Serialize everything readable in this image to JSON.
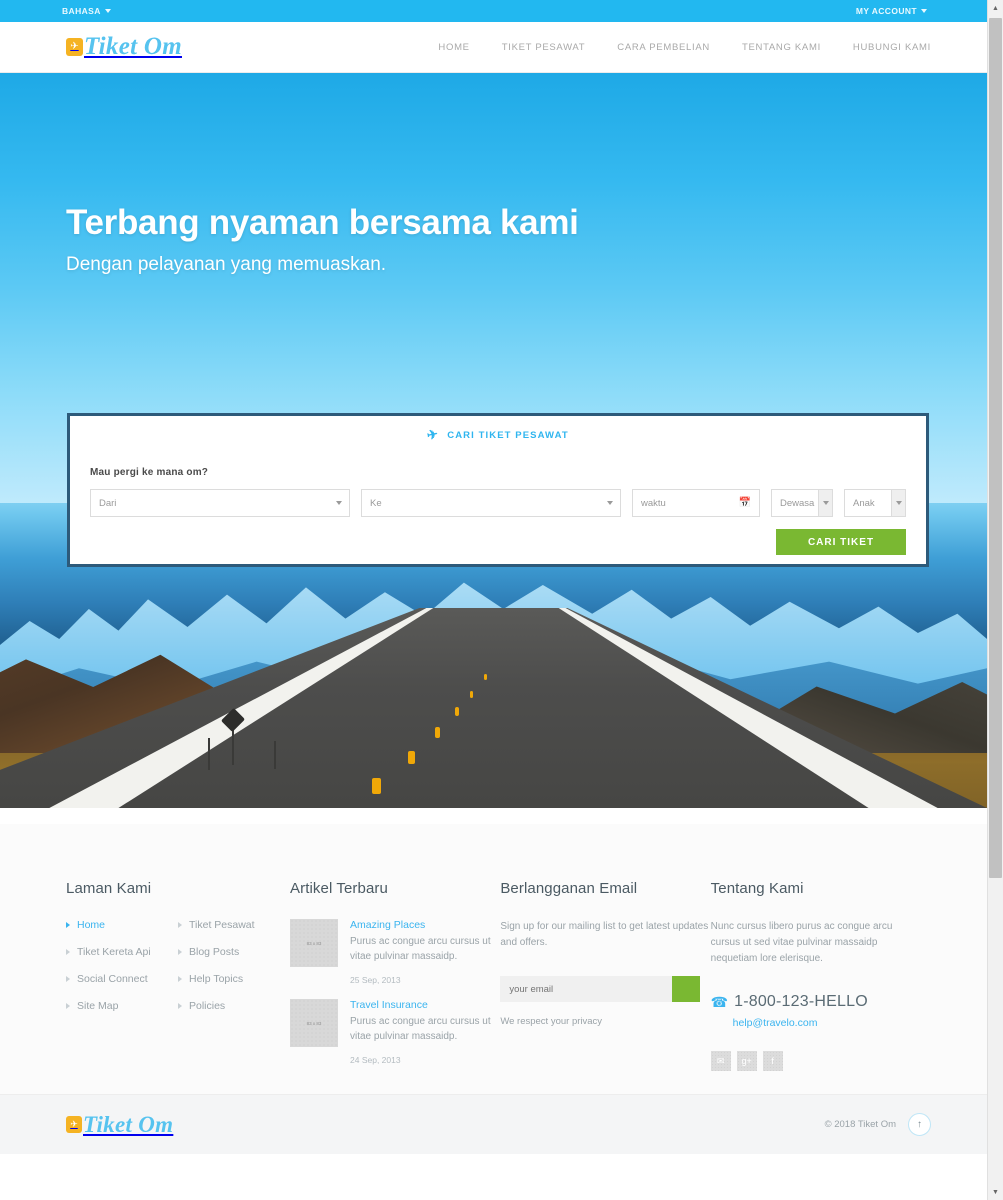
{
  "topbar": {
    "language_label": "BAHASA",
    "account_label": "MY ACCOUNT"
  },
  "header": {
    "logo_text": "Tiket Om",
    "logo_icon": "airplane-icon",
    "nav": [
      {
        "label": "HOME"
      },
      {
        "label": "TIKET PESAWAT"
      },
      {
        "label": "CARA PEMBELIAN"
      },
      {
        "label": "TENTANG KAMI"
      },
      {
        "label": "HUBUNGI KAMI"
      }
    ]
  },
  "hero": {
    "heading": "Terbang nyaman bersama kami",
    "subheading": "Dengan pelayanan yang memuaskan."
  },
  "search": {
    "title": "CARI TIKET PESAWAT",
    "title_icon": "airplane-icon",
    "label": "Mau pergi ke mana om?",
    "from_placeholder": "Dari",
    "to_placeholder": "Ke",
    "date_placeholder": "waktu",
    "date_icon": "calendar-icon",
    "adult_label": "Dewasa",
    "child_label": "Anak",
    "submit_label": "CARI TIKET",
    "submit_color": "#7ab832",
    "border_color": "#2d5a7a"
  },
  "footer": {
    "pages": {
      "heading": "Laman Kami",
      "col1": [
        {
          "label": "Home",
          "active": true
        },
        {
          "label": "Tiket Kereta Api",
          "active": false
        },
        {
          "label": "Social Connect",
          "active": false
        },
        {
          "label": "Site Map",
          "active": false
        }
      ],
      "col2": [
        {
          "label": "Tiket Pesawat",
          "active": false
        },
        {
          "label": "Blog Posts",
          "active": false
        },
        {
          "label": "Help Topics",
          "active": false
        },
        {
          "label": "Policies",
          "active": false
        }
      ]
    },
    "articles": {
      "heading": "Artikel Terbaru",
      "items": [
        {
          "thumb_label": "83 x 83",
          "title": "Amazing Places",
          "desc": "Purus ac congue arcu cursus ut vitae pulvinar massaidp.",
          "date": "25 Sep, 2013"
        },
        {
          "thumb_label": "83 x 83",
          "title": "Travel Insurance",
          "desc": "Purus ac congue arcu cursus ut vitae pulvinar massaidp.",
          "date": "24 Sep, 2013"
        }
      ]
    },
    "subscribe": {
      "heading": "Berlangganan Email",
      "description": "Sign up for our mailing list to get latest updates and offers.",
      "input_placeholder": "your email",
      "button_icon": "submit-arrow",
      "note": "We respect your privacy",
      "button_color": "#7ab832"
    },
    "about": {
      "heading": "Tentang Kami",
      "description": "Nunc cursus libero purus ac congue arcu cursus ut sed vitae pulvinar massaidp nequetiam lore elerisque.",
      "phone": "1-800-123-HELLO",
      "phone_icon": "phone-icon",
      "email": "help@travelo.com",
      "socials": [
        {
          "name": "twitter",
          "glyph": "✉"
        },
        {
          "name": "google-plus",
          "glyph": "g+"
        },
        {
          "name": "facebook",
          "glyph": "f"
        }
      ]
    },
    "bottom": {
      "logo_text": "Tiket Om",
      "copyright": "© 2018 Tiket Om",
      "to_top_icon": "arrow-up-icon"
    }
  },
  "accent_colors": {
    "primary_blue": "#22b8f0",
    "logo_blue": "#56c3ef",
    "logo_orange": "#f5b323",
    "green": "#7ab832"
  }
}
